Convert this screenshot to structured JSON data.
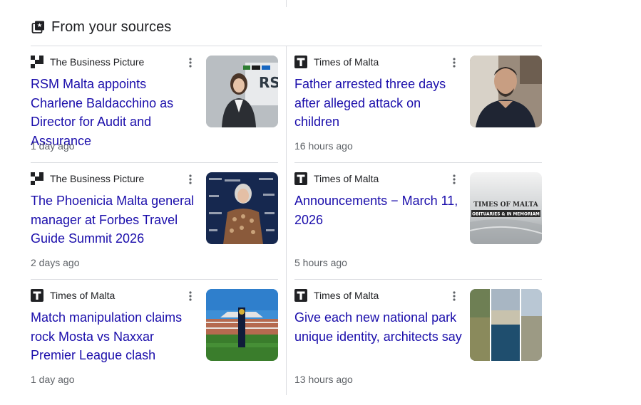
{
  "header": {
    "title": "From your sources",
    "icon": "sources-icon"
  },
  "cards": [
    {
      "source": "The Business Picture",
      "source_logo": "business-picture-logo",
      "headline": "RSM Malta appoints Charlene Baldacchino as Director for Audit and Assurance",
      "time": "1 day ago",
      "thumb_logo_text": "RS"
    },
    {
      "source": "Times of Malta",
      "source_logo": "times-of-malta-logo",
      "headline": "Father arrested three days after alleged attack on children",
      "time": "16 hours ago"
    },
    {
      "source": "The Business Picture",
      "source_logo": "business-picture-logo",
      "headline": "The Phoenicia Malta general manager at Forbes Travel Guide Summit 2026",
      "time": "2 days ago"
    },
    {
      "source": "Times of Malta",
      "source_logo": "times-of-malta-logo",
      "headline": "Announcements − March 11, 2026",
      "time": "5 hours ago",
      "thumb_title": "TIMES OF MALTA",
      "thumb_subtitle": "OBITUARIES & IN MEMORIAM"
    },
    {
      "source": "Times of Malta",
      "source_logo": "times-of-malta-logo",
      "headline": "Match manipulation claims rock Mosta vs Naxxar Premier League clash",
      "time": "1 day ago"
    },
    {
      "source": "Times of Malta",
      "source_logo": "times-of-malta-logo",
      "headline": "Give each new national park unique identity, architects say",
      "time": "13 hours ago"
    }
  ],
  "colors": {
    "headline": "#1a0dab",
    "meta": "#5f6368",
    "divider": "#dadce0"
  }
}
